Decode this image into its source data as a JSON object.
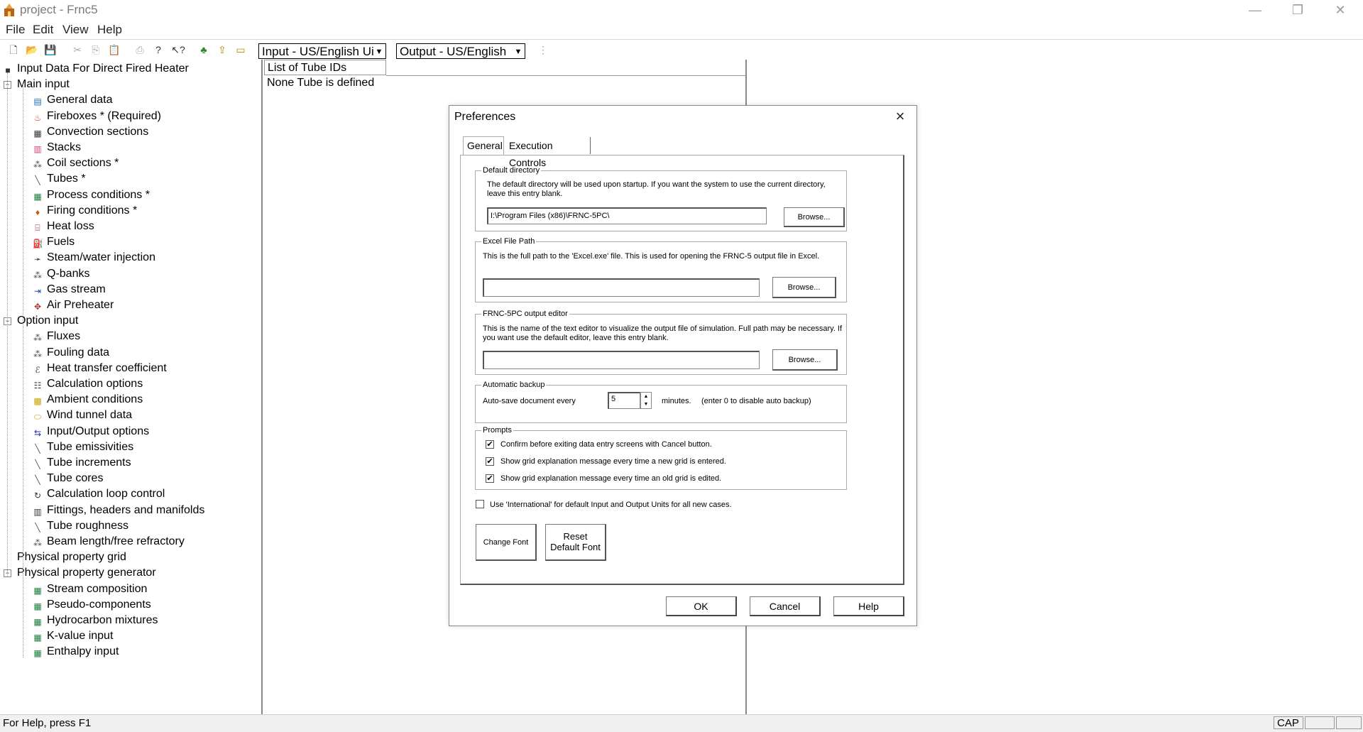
{
  "window": {
    "title": "project - Frnc5",
    "minimize": "—",
    "restore": "❐",
    "close": "✕"
  },
  "menu": [
    "File",
    "Edit",
    "View",
    "Help"
  ],
  "toolbar": {
    "input_units": "Input - US/English Ui",
    "output_units": "Output - US/English"
  },
  "tree": {
    "root": "Input Data For Direct Fired Heater",
    "main_input": {
      "label": "Main input",
      "items": [
        {
          "label": "General data",
          "icon": "general-data-icon"
        },
        {
          "label": "Fireboxes * (Required)",
          "icon": "firebox-icon"
        },
        {
          "label": "Convection sections",
          "icon": "convection-icon"
        },
        {
          "label": "Stacks",
          "icon": "stack-icon"
        },
        {
          "label": "Coil sections *",
          "icon": "coil-icon"
        },
        {
          "label": "Tubes *",
          "icon": "tube-icon"
        },
        {
          "label": "Process conditions *",
          "icon": "grid-icon"
        },
        {
          "label": "Firing conditions *",
          "icon": "flame-icon"
        },
        {
          "label": "Heat loss",
          "icon": "heat-loss-icon"
        },
        {
          "label": "Fuels",
          "icon": "fuel-icon"
        },
        {
          "label": "Steam/water injection",
          "icon": "injection-icon"
        },
        {
          "label": "Q-banks",
          "icon": "coil-icon"
        },
        {
          "label": "Gas stream",
          "icon": "gas-stream-icon"
        },
        {
          "label": "Air Preheater",
          "icon": "preheater-icon"
        }
      ]
    },
    "option_input": {
      "label": "Option input",
      "items": [
        {
          "label": "Fluxes",
          "icon": "coil-icon"
        },
        {
          "label": "Fouling data",
          "icon": "coil-icon"
        },
        {
          "label": "Heat transfer coefficient",
          "icon": "htc-icon"
        },
        {
          "label": "Calculation options",
          "icon": "options-icon"
        },
        {
          "label": "Ambient conditions",
          "icon": "ambient-icon"
        },
        {
          "label": "Wind tunnel data",
          "icon": "wind-icon"
        },
        {
          "label": "Input/Output options",
          "icon": "io-icon"
        },
        {
          "label": "Tube emissivities",
          "icon": "tube-icon"
        },
        {
          "label": "Tube increments",
          "icon": "tube-icon"
        },
        {
          "label": "Tube cores",
          "icon": "tube-icon"
        },
        {
          "label": "Calculation loop control",
          "icon": "loop-icon"
        },
        {
          "label": "Fittings, headers and manifolds",
          "icon": "fittings-icon"
        },
        {
          "label": "Tube roughness",
          "icon": "tube-icon"
        },
        {
          "label": "Beam length/free refractory",
          "icon": "coil-icon"
        }
      ]
    },
    "physical_property_grid": "Physical property grid",
    "generator": {
      "label": "Physical property generator",
      "items": [
        {
          "label": "Stream composition",
          "icon": "grid-icon"
        },
        {
          "label": "Pseudo-components",
          "icon": "grid-icon"
        },
        {
          "label": "Hydrocarbon mixtures",
          "icon": "grid-icon"
        },
        {
          "label": "K-value input",
          "icon": "grid-icon"
        },
        {
          "label": "Enthalpy input",
          "icon": "grid-icon"
        }
      ]
    }
  },
  "list": {
    "header": "List of Tube IDs",
    "empty": "None Tube  is defined"
  },
  "dialog": {
    "title": "Preferences",
    "tabs": [
      "General",
      "Execution Controls"
    ],
    "default_directory": {
      "title": "Default directory",
      "desc": "The default directory will be used upon startup. If you want the system to use the current directory, leave this entry blank.",
      "value": "I:\\Program Files (x86)\\FRNC-5PC\\",
      "browse": "Browse..."
    },
    "excel": {
      "title": "Excel File Path",
      "desc": "This is the full path to the 'Excel.exe' file.  This is used for opening the FRNC-5 output file in Excel.",
      "value": "",
      "browse": "Browse..."
    },
    "editor": {
      "title": "FRNC-5PC output editor",
      "desc": "This is the name of the text editor to visualize the output file of simulation. Full path may be necessary. If you want use the default editor, leave this entry blank.",
      "value": "",
      "browse": "Browse..."
    },
    "backup": {
      "title": "Automatic backup",
      "label": "Auto-save document every",
      "value": "5",
      "unit": "minutes.",
      "hint": "(enter 0 to disable auto backup)"
    },
    "prompts": {
      "title": "Prompts",
      "items": [
        {
          "label": "Confirm before exiting data entry screens with Cancel button.",
          "checked": true
        },
        {
          "label": "Show grid explanation message every time a new grid is entered.",
          "checked": true
        },
        {
          "label": "Show grid explanation message every time an old grid is edited.",
          "checked": true
        }
      ]
    },
    "international": {
      "label": "Use 'International' for default Input and Output Units for all new cases.",
      "checked": false
    },
    "change_font": "Change Font",
    "reset_font_line1": "Reset",
    "reset_font_line2": "Default Font",
    "ok": "OK",
    "cancel": "Cancel",
    "help": "Help"
  },
  "status": {
    "text": "For Help, press F1",
    "cap": "CAP"
  }
}
